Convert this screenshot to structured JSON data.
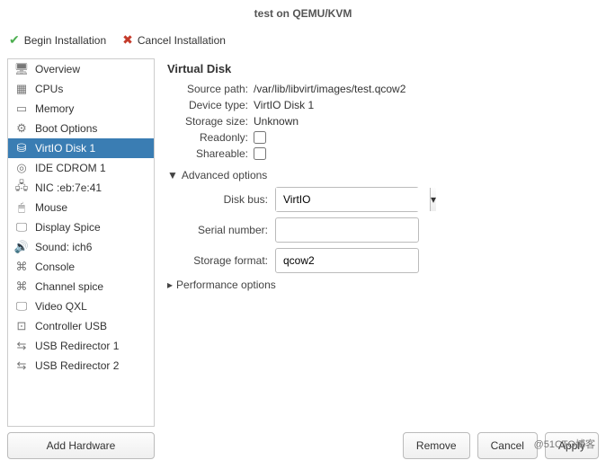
{
  "window": {
    "title": "test on QEMU/KVM"
  },
  "toolbar": {
    "begin_label": "Begin Installation",
    "cancel_label": "Cancel Installation"
  },
  "sidebar": {
    "items": [
      {
        "label": "Overview",
        "icon": "🖥"
      },
      {
        "label": "CPUs",
        "icon": "▦"
      },
      {
        "label": "Memory",
        "icon": "▭"
      },
      {
        "label": "Boot Options",
        "icon": "⚙"
      },
      {
        "label": "VirtIO Disk 1",
        "icon": "⛁"
      },
      {
        "label": "IDE CDROM 1",
        "icon": "◎"
      },
      {
        "label": "NIC :eb:7e:41",
        "icon": "🖧"
      },
      {
        "label": "Mouse",
        "icon": "🖱"
      },
      {
        "label": "Display Spice",
        "icon": "🖵"
      },
      {
        "label": "Sound: ich6",
        "icon": "🔊"
      },
      {
        "label": "Console",
        "icon": "⌘"
      },
      {
        "label": "Channel spice",
        "icon": "⌘"
      },
      {
        "label": "Video QXL",
        "icon": "🖵"
      },
      {
        "label": "Controller USB",
        "icon": "⊡"
      },
      {
        "label": "USB Redirector 1",
        "icon": "⇆"
      },
      {
        "label": "USB Redirector 2",
        "icon": "⇆"
      }
    ],
    "selected_index": 4,
    "add_hardware_label": "Add Hardware"
  },
  "details": {
    "section_title": "Virtual Disk",
    "source_path_label": "Source path:",
    "source_path_value": "/var/lib/libvirt/images/test.qcow2",
    "device_type_label": "Device type:",
    "device_type_value": "VirtIO Disk 1",
    "storage_size_label": "Storage size:",
    "storage_size_value": "Unknown",
    "readonly_label": "Readonly:",
    "readonly_checked": false,
    "shareable_label": "Shareable:",
    "shareable_checked": false,
    "advanced_label": "Advanced options",
    "disk_bus_label": "Disk bus:",
    "disk_bus_value": "VirtIO",
    "serial_label": "Serial number:",
    "serial_value": "",
    "storage_format_label": "Storage format:",
    "storage_format_value": "qcow2",
    "performance_label": "Performance options"
  },
  "footer": {
    "remove_label": "Remove",
    "cancel_label": "Cancel",
    "apply_label": "Apply"
  },
  "watermark": "@51CTO博客"
}
